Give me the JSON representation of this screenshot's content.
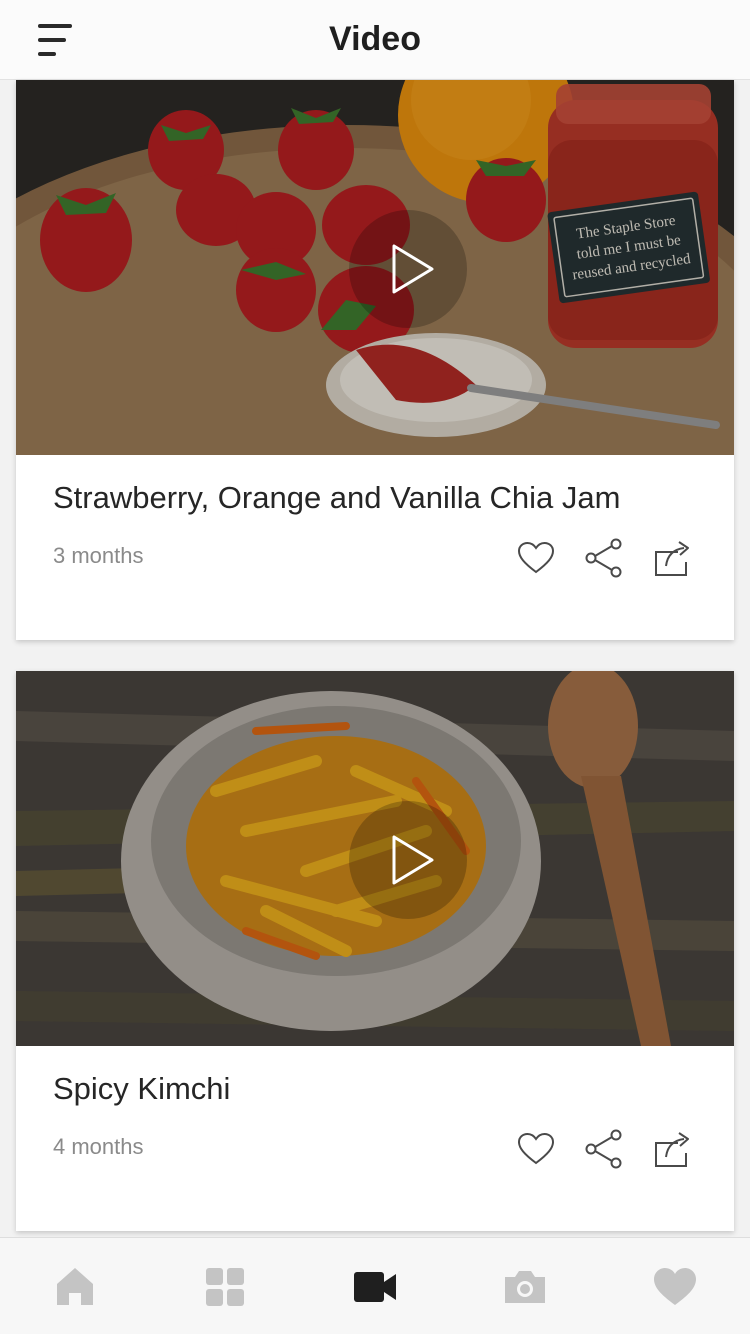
{
  "header": {
    "title": "Video",
    "menu_icon": "hamburger-menu-icon"
  },
  "videos": [
    {
      "title": "Strawberry, Orange and Vanilla Chia Jam",
      "time_ago": "3 months",
      "jar_label": "The Staple Store told me I must be reused and recycled",
      "liked": false
    },
    {
      "title": "Spicy Kimchi",
      "time_ago": "4 months",
      "liked": false
    }
  ],
  "actions": [
    "heart-icon",
    "share-icon",
    "export-icon"
  ],
  "tabs": [
    {
      "icon": "home-icon",
      "active": false
    },
    {
      "icon": "grid-icon",
      "active": false
    },
    {
      "icon": "video-camera-icon",
      "active": true
    },
    {
      "icon": "camera-icon",
      "active": false
    },
    {
      "icon": "heart-icon",
      "active": false
    }
  ],
  "colors": {
    "active_tab": "#1f1f1f",
    "inactive_tab": "#c4c4c4",
    "title_text": "#262626",
    "meta_text": "#8a8a8a"
  }
}
